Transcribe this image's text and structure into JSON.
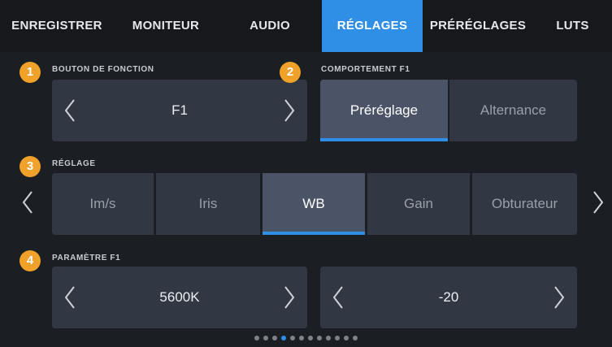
{
  "tabs": [
    {
      "label": "ENREGISTRER",
      "active": false
    },
    {
      "label": "MONITEUR",
      "active": false
    },
    {
      "label": "AUDIO",
      "active": false
    },
    {
      "label": "RÉGLAGES",
      "active": true
    },
    {
      "label": "PRÉRÉGLAGES",
      "active": false
    },
    {
      "label": "LUTS",
      "active": false
    }
  ],
  "sections": {
    "function_button": {
      "badge": "1",
      "label": "BOUTON DE FONCTION",
      "value": "F1"
    },
    "f1_behavior": {
      "badge": "2",
      "label": "COMPORTEMENT F1",
      "options": [
        "Préréglage",
        "Alternance"
      ],
      "selected": "Préréglage"
    },
    "setting": {
      "badge": "3",
      "label": "RÉGLAGE",
      "options": [
        "Im/s",
        "Iris",
        "WB",
        "Gain",
        "Obturateur"
      ],
      "selected": "WB"
    },
    "f1_parameter": {
      "badge": "4",
      "label": "PARAMÈTRE F1",
      "value_1": "5600K",
      "value_2": "-20"
    }
  },
  "pagination": {
    "total": 12,
    "current": 4
  },
  "colors": {
    "accent": "#2f8fe6",
    "badge": "#f0a12a",
    "panel": "#313743",
    "selected_panel": "#4b5466"
  }
}
